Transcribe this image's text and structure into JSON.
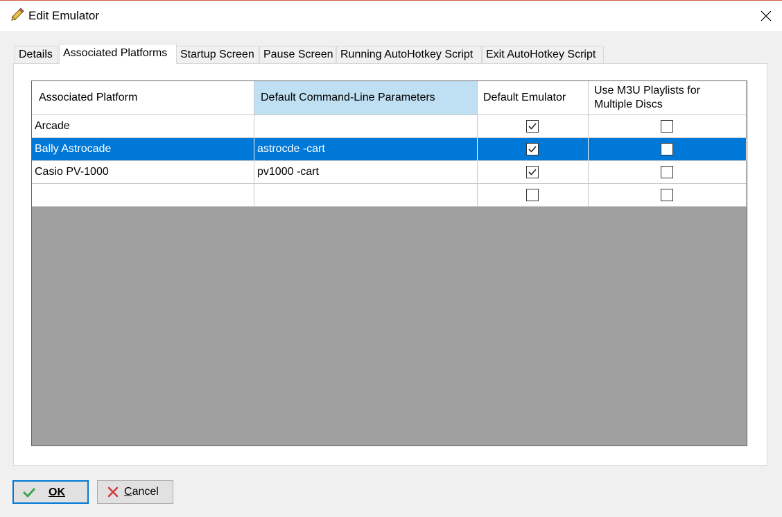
{
  "window": {
    "title": "Edit Emulator"
  },
  "tabs": [
    {
      "label": "Details",
      "active": false
    },
    {
      "label": "Associated Platforms",
      "active": true
    },
    {
      "label": "Startup Screen",
      "active": false
    },
    {
      "label": "Pause Screen",
      "active": false
    },
    {
      "label": "Running AutoHotkey Script",
      "active": false
    },
    {
      "label": "Exit AutoHotkey Script",
      "active": false
    }
  ],
  "grid": {
    "columns": [
      {
        "label": "Associated Platform"
      },
      {
        "label": "Default Command-Line Parameters"
      },
      {
        "label": "Default Emulator"
      },
      {
        "label": "Use M3U Playlists for\nMultiple Discs"
      }
    ],
    "rows": [
      {
        "platform": "Arcade",
        "params": "",
        "default_emulator": true,
        "m3u": false,
        "selected": false
      },
      {
        "platform": "Bally Astrocade",
        "params": "astrocde -cart",
        "default_emulator": true,
        "m3u": false,
        "selected": true
      },
      {
        "platform": "Casio PV-1000",
        "params": "pv1000 -cart",
        "default_emulator": true,
        "m3u": false,
        "selected": false
      },
      {
        "platform": "",
        "params": "",
        "default_emulator": false,
        "m3u": false,
        "selected": false
      }
    ]
  },
  "buttons": {
    "ok": "OK",
    "cancel": "Cancel"
  },
  "colors": {
    "selection": "#0078d7",
    "header_selected": "#bfdff2",
    "grid_empty": "#a0a0a0"
  }
}
